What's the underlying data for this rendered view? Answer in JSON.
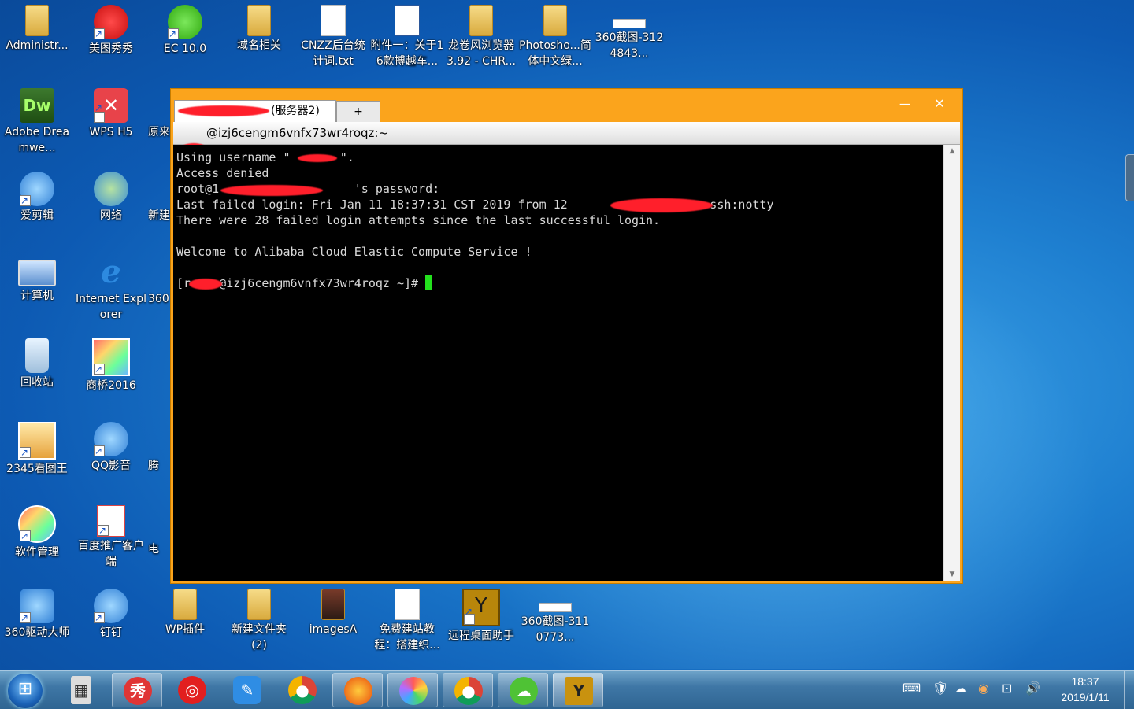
{
  "desktop": {
    "icons": [
      {
        "label": "Administr...",
        "icon": "user-folder-icon"
      },
      {
        "label": "美图秀秀",
        "icon": "meitu-icon"
      },
      {
        "label": "EC 10.0",
        "icon": "ec-icon"
      },
      {
        "label": "域名相关",
        "icon": "folder-icon"
      },
      {
        "label": "CNZZ后台统计词.txt",
        "icon": "text-file-icon"
      },
      {
        "label": "附件一：关于16款搏越车...",
        "icon": "word-doc-icon"
      },
      {
        "label": "龙卷风浏览器3.92 - CHR...",
        "icon": "folder-icon"
      },
      {
        "label": "Photosho...简体中文绿...",
        "icon": "folder-icon"
      },
      {
        "label": "360截图-3124843...",
        "icon": "screenshot-icon"
      },
      {
        "label": "Adobe Dreamwe...",
        "icon": "dreamweaver-icon"
      },
      {
        "label": "WPS H5",
        "icon": "wps-h5-icon"
      },
      {
        "label": "原来",
        "icon": "partial-icon"
      },
      {
        "label": "爱剪辑",
        "icon": "aijianji-icon"
      },
      {
        "label": "网络",
        "icon": "network-icon"
      },
      {
        "label": "新建",
        "icon": "partial-icon"
      },
      {
        "label": "计算机",
        "icon": "computer-icon"
      },
      {
        "label": "Internet Explorer",
        "icon": "ie-icon"
      },
      {
        "label": "360",
        "icon": "partial-icon"
      },
      {
        "label": "回收站",
        "icon": "recycle-bin-icon"
      },
      {
        "label": "商桥2016",
        "icon": "shangqiao-icon"
      },
      {
        "label": "2345看图王",
        "icon": "2345-viewer-icon"
      },
      {
        "label": "QQ影音",
        "icon": "qq-player-icon"
      },
      {
        "label": "腾",
        "icon": "partial-icon"
      },
      {
        "label": "软件管理",
        "icon": "software-manager-icon"
      },
      {
        "label": "百度推广客户端",
        "icon": "baidu-promo-icon"
      },
      {
        "label": "电",
        "icon": "partial-icon"
      },
      {
        "label": "360驱动大师",
        "icon": "driver-master-icon"
      },
      {
        "label": "钉钉",
        "icon": "dingtalk-icon"
      },
      {
        "label": "WP插件",
        "icon": "folder-icon"
      },
      {
        "label": "新建文件夹 (2)",
        "icon": "folder-icon"
      },
      {
        "label": "imagesA",
        "icon": "folder-icon"
      },
      {
        "label": "免费建站教程：搭建织...",
        "icon": "video-file-icon"
      },
      {
        "label": "远程桌面助手",
        "icon": "remote-desktop-icon"
      },
      {
        "label": "360截图-3110773...",
        "icon": "screenshot-icon"
      }
    ]
  },
  "window": {
    "tab_label": "(服务器2)",
    "new_tab_label": "+",
    "minimize": "−",
    "close": "✕",
    "session_title": "@izj6cengm6vnfx73wr4roqz:~"
  },
  "terminal": {
    "lines": [
      "Using username \"       \".",
      "Access denied",
      "root@1                   's password:",
      "Last failed login: Fri Jan 11 18:37:31 CST 2019 from 12                 on ssh:notty",
      "There were 28 failed login attempts since the last successful login.",
      "",
      "Welcome to Alibaba Cloud Elastic Compute Service !",
      "",
      "[r    @izj6cengm6vnfx73wr4roqz ~]# "
    ]
  },
  "taskbar": {
    "apps": [
      "calculator-icon",
      "meitu-icon",
      "netease-music-icon",
      "notes-icon",
      "chrome-icon",
      "firefox-icon",
      "photos-icon",
      "chrome-icon",
      "wechat-icon",
      "remote-desktop-icon"
    ],
    "clock_time": "18:37",
    "clock_date": "2019/1/11"
  },
  "colors": {
    "window_frame": "#fba41c",
    "cursor": "#23e01d",
    "redaction": "#ff1f2b"
  }
}
